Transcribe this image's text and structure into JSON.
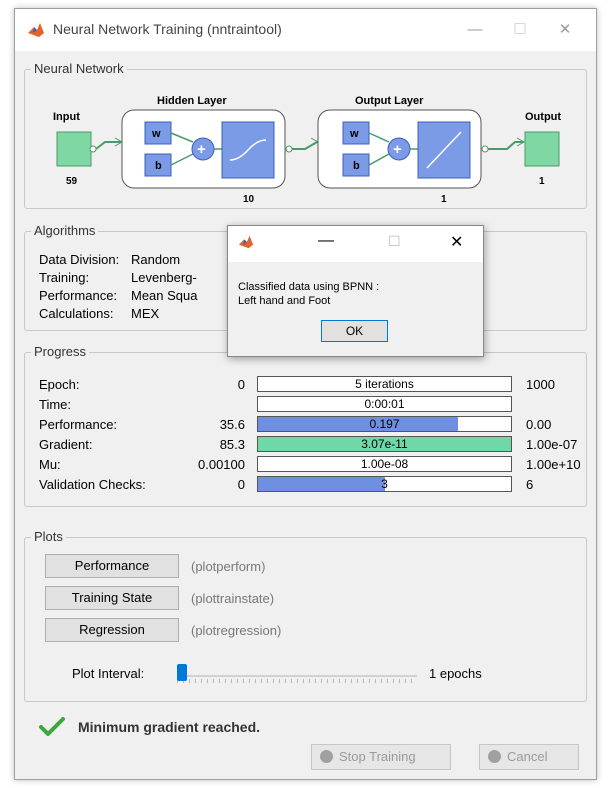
{
  "window": {
    "title": "Neural Network Training (nntraintool)",
    "minimize": "—",
    "maximize": "☐",
    "close": "✕"
  },
  "network": {
    "group_label": "Neural Network",
    "input_label": "Input",
    "input_size": "59",
    "hidden_label": "Hidden Layer",
    "hidden_size": "10",
    "output_layer_label": "Output Layer",
    "output_layer_size": "1",
    "output_label": "Output",
    "output_size": "1",
    "w": "w",
    "b": "b",
    "plus": "+"
  },
  "algorithms": {
    "group_label": "Algorithms",
    "rows": [
      {
        "key": "Data Division:",
        "value": "Random"
      },
      {
        "key": "Training:",
        "value": "Levenberg-"
      },
      {
        "key": "Performance:",
        "value": "Mean Squa"
      },
      {
        "key": "Calculations:",
        "value": "MEX"
      }
    ]
  },
  "progress": {
    "group_label": "Progress",
    "rows": [
      {
        "label": "Epoch:",
        "start": "0",
        "value": "5 iterations",
        "end": "1000",
        "fill": 0,
        "color": "#6f8fe0"
      },
      {
        "label": "Time:",
        "start": "",
        "value": "0:00:01",
        "end": "",
        "fill": 0,
        "color": "#6f8fe0"
      },
      {
        "label": "Performance:",
        "start": "35.6",
        "value": "0.197",
        "end": "0.00",
        "fill": 0.79,
        "color": "#6f8fe0"
      },
      {
        "label": "Gradient:",
        "start": "85.3",
        "value": "3.07e-11",
        "end": "1.00e-07",
        "fill": 1.0,
        "color": "#70d8a8"
      },
      {
        "label": "Mu:",
        "start": "0.00100",
        "value": "1.00e-08",
        "end": "1.00e+10",
        "fill": 0,
        "color": "#6f8fe0"
      },
      {
        "label": "Validation Checks:",
        "start": "0",
        "value": "3",
        "end": "6",
        "fill": 0.5,
        "color": "#6f8fe0"
      }
    ]
  },
  "plots": {
    "group_label": "Plots",
    "buttons": [
      {
        "label": "Performance",
        "fn": "(plotperform)"
      },
      {
        "label": "Training State",
        "fn": "(plottrainstate)"
      },
      {
        "label": "Regression",
        "fn": "(plotregression)"
      }
    ],
    "interval_label": "Plot Interval:",
    "interval_value": "1 epochs",
    "interval_fraction": 0.0
  },
  "status": {
    "message": "Minimum gradient reached."
  },
  "footer": {
    "stop_label": "Stop Training",
    "cancel_label": "Cancel"
  },
  "dialog": {
    "message_line1": "Classified data using BPNN :",
    "message_line2": "Left hand and Foot",
    "ok_label": "OK",
    "minimize": "—",
    "maximize": "☐",
    "close": "✕"
  },
  "colors": {
    "layer_fill": "#7b9be6",
    "io_fill": "#7fd8a4",
    "accent_blue": "#0078d7",
    "check_green": "#3aa83a"
  }
}
